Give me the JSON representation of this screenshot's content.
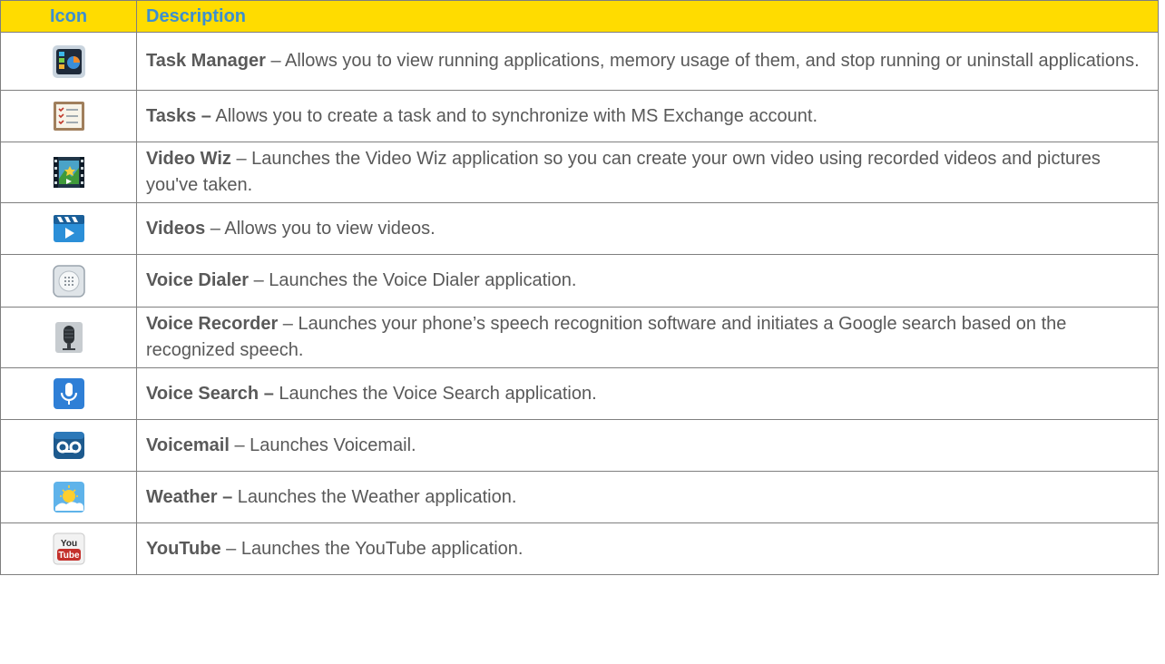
{
  "header": {
    "icon": "Icon",
    "description": "Description"
  },
  "rows": [
    {
      "icon": "task-manager-icon",
      "name": "Task Manager",
      "sep": " – ",
      "text": "Allows you to view running applications, memory usage of them, and stop running or uninstall applications."
    },
    {
      "icon": "tasks-icon",
      "name": "Tasks –",
      "sep": " ",
      "text": "Allows you to create a task and to synchronize with MS Exchange account."
    },
    {
      "icon": "video-wiz-icon",
      "name": "Video Wiz",
      "sep": " – ",
      "text": "Launches the Video Wiz application so you can create your own video using recorded videos and pictures you've taken."
    },
    {
      "icon": "videos-icon",
      "name": "Videos",
      "sep": " – ",
      "text": "Allows you to view videos."
    },
    {
      "icon": "voice-dialer-icon",
      "name": "Voice Dialer",
      "sep": " – ",
      "text": "Launches the Voice Dialer application."
    },
    {
      "icon": "voice-recorder-icon",
      "name": "Voice Recorder",
      "sep": " – ",
      "text": "Launches your phone’s speech recognition software and initiates a Google search based on the recognized speech."
    },
    {
      "icon": "voice-search-icon",
      "name": "Voice Search –",
      "sep": " ",
      "text": "Launches the Voice Search application."
    },
    {
      "icon": "voicemail-icon",
      "name": "Voicemail",
      "sep": " – ",
      "text": "Launches Voicemail."
    },
    {
      "icon": "weather-icon",
      "name": "Weather –",
      "sep": " ",
      "text": "Launches the Weather application."
    },
    {
      "icon": "youtube-icon",
      "name": "YouTube",
      "sep": " – ",
      "text": "Launches the YouTube application.",
      "icon_text_top": "You",
      "icon_text_bottom": "Tube"
    }
  ],
  "colors": {
    "header_bg": "#ffdc00",
    "header_text": "#3c8fd0",
    "body_text": "#595959",
    "border": "#7f7f7f"
  }
}
